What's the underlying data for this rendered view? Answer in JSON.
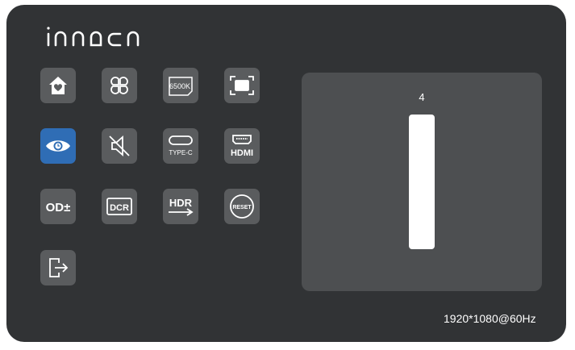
{
  "brand": {
    "logo_text": "innocn"
  },
  "menu": {
    "items": [
      {
        "id": "home",
        "icon": "home-icon",
        "active": false
      },
      {
        "id": "picture-mode",
        "icon": "four-petal-icon",
        "active": false
      },
      {
        "id": "color-temp",
        "icon": "color-temperature-icon",
        "label": "6500K",
        "active": false
      },
      {
        "id": "display-size",
        "icon": "screen-frame-icon",
        "active": false
      },
      {
        "id": "eye-care",
        "icon": "eye-icon",
        "active": true
      },
      {
        "id": "mute",
        "icon": "speaker-mute-icon",
        "active": false
      },
      {
        "id": "type-c-input",
        "icon": "usb-c-icon",
        "label": "TYPE-C",
        "active": false
      },
      {
        "id": "hdmi-input",
        "icon": "hdmi-icon",
        "label": "HDMI",
        "active": false
      },
      {
        "id": "od",
        "icon": "overdrive-icon",
        "label": "OD±",
        "active": false
      },
      {
        "id": "dcr",
        "icon": "dcr-icon",
        "label": "DCR",
        "active": false
      },
      {
        "id": "hdr",
        "icon": "hdr-icon",
        "label": "HDR",
        "active": false
      },
      {
        "id": "reset",
        "icon": "reset-icon",
        "label": "RESET",
        "active": false
      },
      {
        "id": "exit",
        "icon": "exit-icon",
        "active": false
      }
    ]
  },
  "adjust_panel": {
    "value": "4",
    "level_fraction": 1.0
  },
  "status": {
    "resolution": "1920*1080@60Hz"
  },
  "colors": {
    "background": "#313335",
    "button": "#5a5c5e",
    "active": "#2f6db5",
    "panel": "#4d4f51"
  }
}
